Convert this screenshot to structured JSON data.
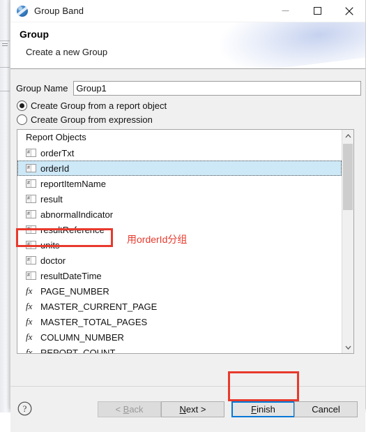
{
  "window": {
    "title": "Group Band",
    "icon": "birt-logo-icon",
    "controls": {
      "minimize": "minimize-icon",
      "maximize": "maximize-icon",
      "close": "close-icon"
    }
  },
  "header": {
    "title": "Group",
    "subtitle": "Create a new Group"
  },
  "form": {
    "group_name_label": "Group Name",
    "group_name_value": "Group1",
    "group_name_placeholder": "",
    "radio_report_object": "Create Group from a report object",
    "radio_expression": "Create Group from expression",
    "selected_radio": "report_object"
  },
  "list": {
    "header": "Report Objects",
    "selected": "orderId",
    "items": [
      {
        "label": "orderTxt",
        "icon": "field-icon"
      },
      {
        "label": "orderId",
        "icon": "field-icon"
      },
      {
        "label": "reportItemName",
        "icon": "field-icon"
      },
      {
        "label": "result",
        "icon": "field-icon"
      },
      {
        "label": "abnormalIndicator",
        "icon": "field-icon"
      },
      {
        "label": "resultReference",
        "icon": "field-icon"
      },
      {
        "label": "units",
        "icon": "field-icon"
      },
      {
        "label": "doctor",
        "icon": "field-icon"
      },
      {
        "label": "resultDateTime",
        "icon": "field-icon"
      },
      {
        "label": "PAGE_NUMBER",
        "icon": "fx-icon"
      },
      {
        "label": "MASTER_CURRENT_PAGE",
        "icon": "fx-icon"
      },
      {
        "label": "MASTER_TOTAL_PAGES",
        "icon": "fx-icon"
      },
      {
        "label": "COLUMN_NUMBER",
        "icon": "fx-icon"
      },
      {
        "label": "REPORT_COUNT",
        "icon": "fx-icon"
      }
    ],
    "scrollbar": {
      "up_arrow": "chevron-up-icon",
      "down_arrow": "chevron-down-icon"
    }
  },
  "annotations": {
    "orderid_note": "用orderId分组",
    "highlight_color": "#e8392c"
  },
  "footer": {
    "help": "?",
    "back": "< Back",
    "next": "Next >",
    "finish": "Finish",
    "cancel": "Cancel",
    "back_enabled": false,
    "focused_button": "Finish",
    "focus_color": "#0078d7"
  }
}
